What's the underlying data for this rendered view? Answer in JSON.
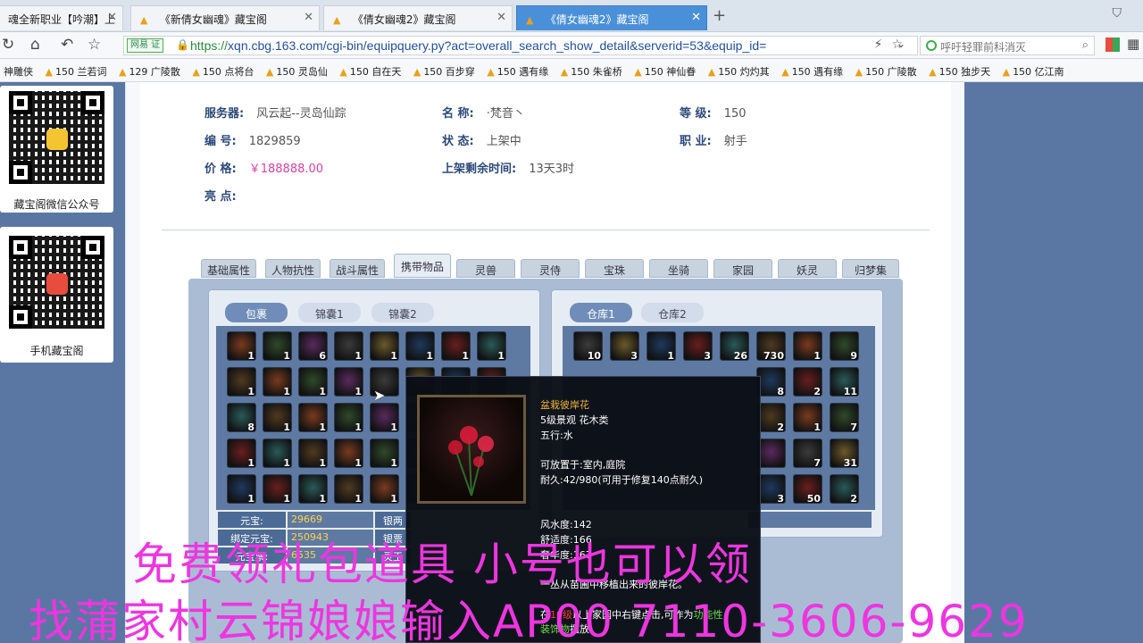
{
  "browser": {
    "tabs": [
      {
        "label": "魂全新职业【吟潮】上",
        "active": false
      },
      {
        "label": "《新倩女幽魂》藏宝阁",
        "active": false
      },
      {
        "label": "《倩女幽魂2》藏宝阁",
        "active": false
      },
      {
        "label": "《倩女幽魂2》藏宝阁",
        "active": true
      }
    ],
    "new_tab": "+",
    "url_badge": "网易 证",
    "url_scheme": "https://",
    "url_rest": "xqn.cbg.163.com/cgi-bin/equipquery.py?act=overall_search_show_detail&serverid=53&equip_id=",
    "search_text": "呼吁轻罪前科消灭",
    "bookmarks": [
      "神雕侠",
      "150 兰若词",
      "129 广陵散",
      "150 点将台",
      "150 灵岛仙",
      "150 自在天",
      "150 百步穿",
      "150 遇有缘",
      "150 朱雀桥",
      "150 神仙眷",
      "150 灼灼其",
      "150 遇有缘",
      "150 广陵散",
      "150 独步天",
      "150 亿江南"
    ]
  },
  "sidebar": {
    "qr1_caption": "藏宝阁微信公众号",
    "qr2_caption": "手机藏宝阁"
  },
  "info": {
    "server_label": "服务器:",
    "server_value": "风云起--灵岛仙踪",
    "name_label": "名 称:",
    "name_value": "·梵音丶",
    "level_label": "等 级:",
    "level_value": "150",
    "id_label": "编 号:",
    "id_value": "1829859",
    "status_label": "状 态:",
    "status_value": "上架中",
    "job_label": "职 业:",
    "job_value": "射手",
    "price_label": "价 格:",
    "price_value": "￥188888.00",
    "remain_label": "上架剩余时间:",
    "remain_value": "13天3时",
    "highlight_label": "亮 点:"
  },
  "main_tabs": [
    "基础属性",
    "人物抗性",
    "战斗属性",
    "携带物品",
    "灵兽",
    "灵侍",
    "宝珠",
    "坐骑",
    "家园",
    "妖灵",
    "归梦集"
  ],
  "active_main_tab": 3,
  "bag": {
    "tabs": [
      "包裹",
      "锦囊1",
      "锦囊2"
    ],
    "counts": [
      "1",
      "1",
      "6",
      "1",
      "1",
      "1",
      "1",
      "1",
      "1",
      "1",
      "1",
      "1",
      "",
      "",
      "",
      "",
      "8",
      "1",
      "1",
      "1",
      "1",
      "",
      "",
      "",
      "1",
      "1",
      "1",
      "1",
      "1",
      "",
      "",
      "",
      "1",
      "1",
      "1",
      "1",
      "1",
      "",
      "",
      ""
    ],
    "money": [
      {
        "label": "元宝:",
        "value": "29669",
        "label2": "银两"
      },
      {
        "label": "绑定元宝:",
        "value": "250943",
        "label2": "银票"
      },
      {
        "label": "元宝票:",
        "value": "6535",
        "label2": "灵玉"
      }
    ]
  },
  "warehouse": {
    "tabs": [
      "仓库1",
      "仓库2"
    ],
    "row1_counts": [
      "10",
      "3",
      "1",
      "3",
      "26",
      "730",
      "1",
      "9"
    ],
    "right_counts": [
      "8",
      "2",
      "11",
      "2",
      "1",
      "7",
      "",
      "7",
      "31",
      "3",
      "50",
      "2"
    ]
  },
  "tooltip": {
    "name": "盆栽彼岸花",
    "line1": "5级景观 花木类",
    "line2": "五行:水",
    "line3": "可放置于:室内,庭院",
    "line4": "耐久:42/980(可用于修复140点耐久)",
    "line5": "风水度:142",
    "line6": "舒适度:166",
    "line7": "奢华度:167",
    "line8": "一丛从苗圃中移植出来的彼岸花。",
    "line9_a": "在",
    "line9_b": "10级",
    "line9_c": "以上家园中右键点击,可作为",
    "line9_d": "功能性",
    "line10_a": "装饰物",
    "line10_b": "摆放。"
  },
  "overlay": {
    "line1": "免费领礼包道具 小号也可以领",
    "line2": "找蒲家村云锦娘娘输入AP00 7110-3606-9629"
  }
}
